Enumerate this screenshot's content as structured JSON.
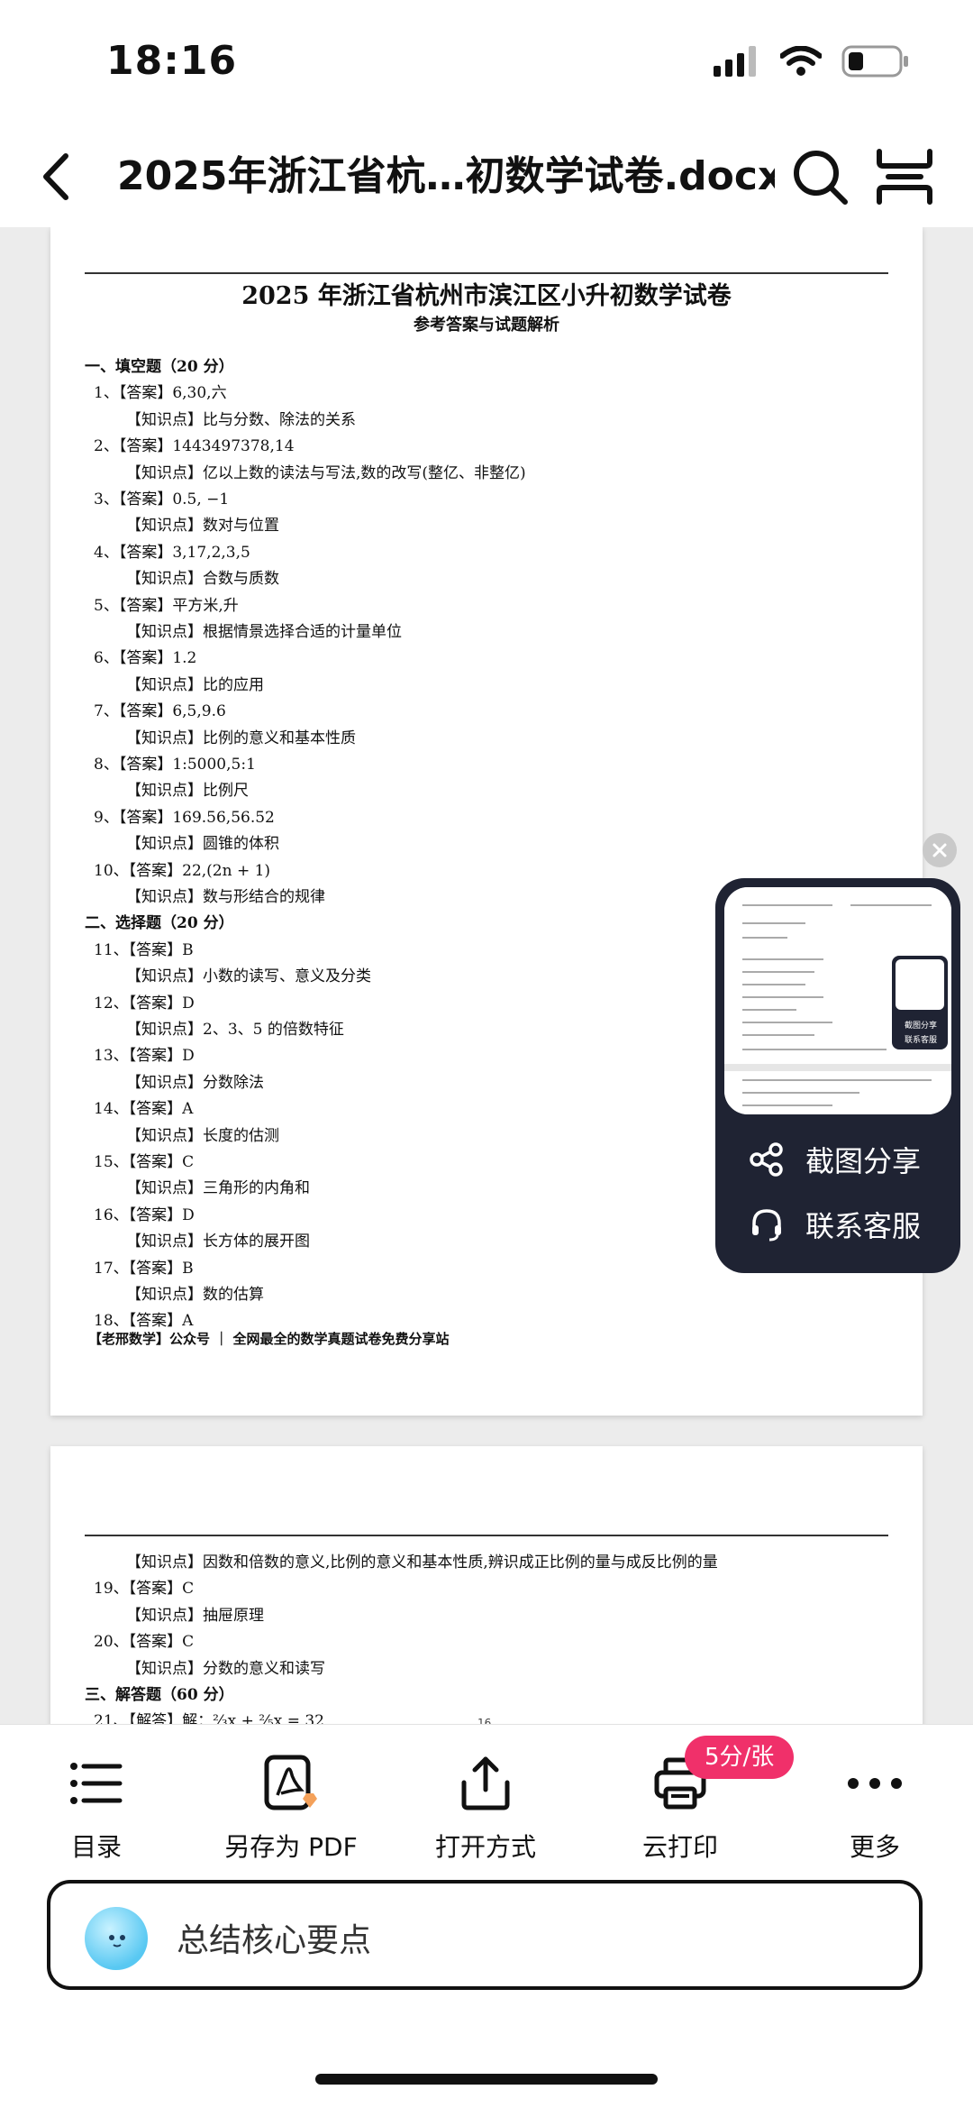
{
  "status": {
    "time": "18:16"
  },
  "nav": {
    "title": "2025年浙江省杭…初数学试卷.docx"
  },
  "document": {
    "title": "2025 年浙江省杭州市滨江区小升初数学试卷",
    "subtitle": "参考答案与试题解析",
    "page1_lines": [
      {
        "type": "sec",
        "text": "一、填空题（20 分）"
      },
      {
        "type": "ans",
        "text": "1、【答案】6,30,六"
      },
      {
        "type": "kp",
        "text": "【知识点】比与分数、除法的关系"
      },
      {
        "type": "ans",
        "text": "2、【答案】1443497378,14"
      },
      {
        "type": "kp",
        "text": "【知识点】亿以上数的读法与写法,数的改写(整亿、非整亿)"
      },
      {
        "type": "ans",
        "text": "3、【答案】0.5, −1"
      },
      {
        "type": "kp",
        "text": "【知识点】数对与位置"
      },
      {
        "type": "ans",
        "text": "4、【答案】3,17,2,3,5"
      },
      {
        "type": "kp",
        "text": "【知识点】合数与质数"
      },
      {
        "type": "ans",
        "text": "5、【答案】平方米,升"
      },
      {
        "type": "kp",
        "text": "【知识点】根据情景选择合适的计量单位"
      },
      {
        "type": "ans",
        "text": "6、【答案】1.2"
      },
      {
        "type": "kp",
        "text": "【知识点】比的应用"
      },
      {
        "type": "ans",
        "text": "7、【答案】6,5,9.6"
      },
      {
        "type": "kp",
        "text": "【知识点】比例的意义和基本性质"
      },
      {
        "type": "ans",
        "text": "8、【答案】1:5000,5:1"
      },
      {
        "type": "kp",
        "text": "【知识点】比例尺"
      },
      {
        "type": "ans",
        "text": "9、【答案】169.56,56.52"
      },
      {
        "type": "kp",
        "text": "【知识点】圆锥的体积"
      },
      {
        "type": "ans",
        "text": "10、【答案】22,(2n + 1)"
      },
      {
        "type": "kp",
        "text": "【知识点】数与形结合的规律"
      },
      {
        "type": "sec",
        "text": "二、选择题（20 分）"
      },
      {
        "type": "ans",
        "text": "11、【答案】B"
      },
      {
        "type": "kp",
        "text": "【知识点】小数的读写、意义及分类"
      },
      {
        "type": "ans",
        "text": "12、【答案】D"
      },
      {
        "type": "kp",
        "text": "【知识点】2、3、5 的倍数特征"
      },
      {
        "type": "ans",
        "text": "13、【答案】D"
      },
      {
        "type": "kp",
        "text": "【知识点】分数除法"
      },
      {
        "type": "ans",
        "text": "14、【答案】A"
      },
      {
        "type": "kp",
        "text": "【知识点】长度的估测"
      },
      {
        "type": "ans",
        "text": "15、【答案】C"
      },
      {
        "type": "kp",
        "text": "【知识点】三角形的内角和"
      },
      {
        "type": "ans",
        "text": "16、【答案】D"
      },
      {
        "type": "kp",
        "text": "【知识点】长方体的展开图"
      },
      {
        "type": "ans",
        "text": "17、【答案】B"
      },
      {
        "type": "kp",
        "text": "【知识点】数的估算"
      },
      {
        "type": "ans",
        "text": "18、【答案】A"
      }
    ],
    "page1_footer": "【老邢数学】公众号 ｜ 全网最全的数学真题试卷免费分享站",
    "page2_lines": [
      {
        "type": "kp",
        "text": "【知识点】因数和倍数的意义,比例的意义和基本性质,辨识成正比例的量与成反比例的量"
      },
      {
        "type": "ans",
        "text": "19、【答案】C"
      },
      {
        "type": "kp",
        "text": "【知识点】抽屉原理"
      },
      {
        "type": "ans",
        "text": "20、【答案】C"
      },
      {
        "type": "kp",
        "text": "【知识点】分数的意义和读写"
      },
      {
        "type": "sec",
        "text": "三、解答题（60 分）"
      },
      {
        "type": "ans",
        "text": "21、【解答】解：⅔x + ⅖x = 32"
      }
    ],
    "page2_number": "16"
  },
  "float_menu": {
    "share_label": "截图分享",
    "service_label": "联系客服",
    "mini_share_label": "截图分享",
    "mini_service_label": "联系客服"
  },
  "toolbar": {
    "items": [
      {
        "label": "目录",
        "icon": "list-icon"
      },
      {
        "label": "另存为 PDF",
        "icon": "pdf-icon"
      },
      {
        "label": "打开方式",
        "icon": "share-icon"
      },
      {
        "label": "云打印",
        "icon": "printer-icon"
      },
      {
        "label": "更多",
        "icon": "more-icon"
      }
    ],
    "print_badge": "5分/张"
  },
  "ai_prompt": {
    "text": "总结核心要点"
  }
}
